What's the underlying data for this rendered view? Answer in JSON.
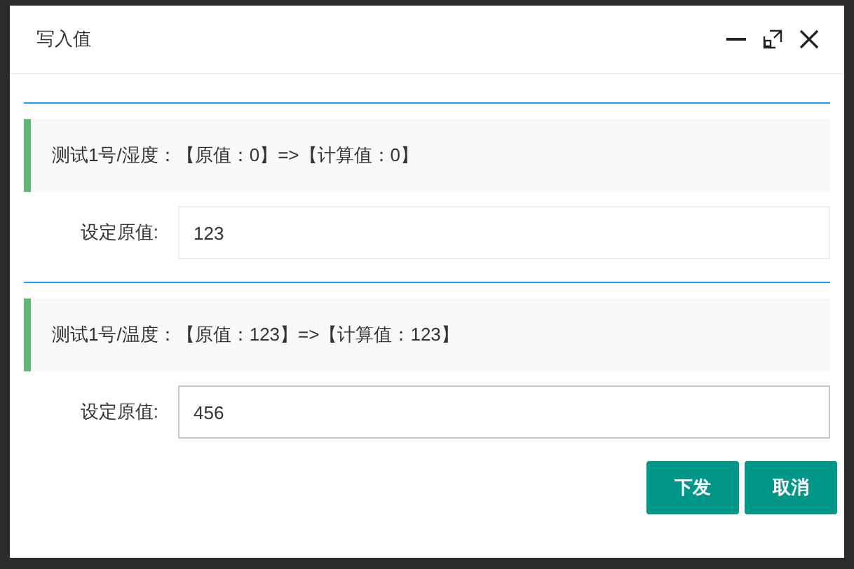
{
  "window": {
    "title": "写入值"
  },
  "items": [
    {
      "info": "测试1号/湿度：【原值：0】=>【计算值：0】",
      "label": "设定原值:",
      "value": "123",
      "focused": false
    },
    {
      "info": "测试1号/温度：【原值：123】=>【计算值：123】",
      "label": "设定原值:",
      "value": "456",
      "focused": true
    }
  ],
  "buttons": [
    "下发",
    "取消"
  ]
}
